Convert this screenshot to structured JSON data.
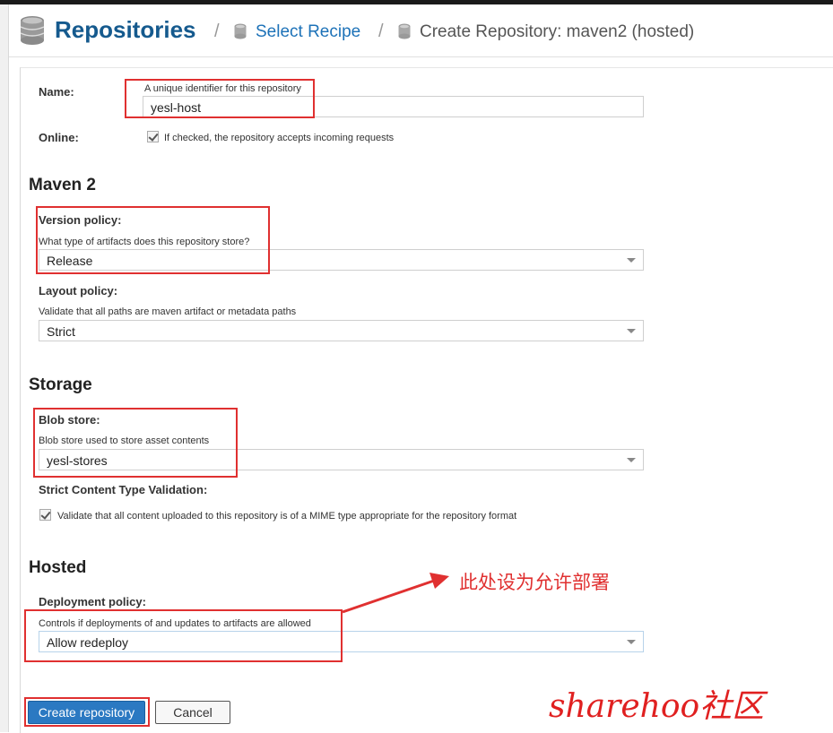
{
  "breadcrumb": {
    "title": "Repositories",
    "separator": "/",
    "link": "Select Recipe",
    "current": "Create Repository: maven2 (hosted)"
  },
  "form": {
    "name": {
      "label": "Name:",
      "help": "A unique identifier for this repository",
      "value": "yesl-host"
    },
    "online": {
      "label": "Online:",
      "checked": true,
      "help": "If checked, the repository accepts incoming requests"
    },
    "maven": {
      "section_title": "Maven 2",
      "version_policy": {
        "label": "Version policy:",
        "help": "What type of artifacts does this repository store?",
        "value": "Release"
      },
      "layout_policy": {
        "label": "Layout policy:",
        "help": "Validate that all paths are maven artifact or metadata paths",
        "value": "Strict"
      }
    },
    "storage": {
      "section_title": "Storage",
      "blob_store": {
        "label": "Blob store:",
        "help": "Blob store used to store asset contents",
        "value": "yesl-stores"
      },
      "strict_content": {
        "label": "Strict Content Type Validation:",
        "checked": true,
        "help": "Validate that all content uploaded to this repository is of a MIME type appropriate for the repository format"
      }
    },
    "hosted": {
      "section_title": "Hosted",
      "deployment_policy": {
        "label": "Deployment policy:",
        "help": "Controls if deployments of and updates to artifacts are allowed",
        "value": "Allow redeploy"
      }
    },
    "buttons": {
      "create": "Create repository",
      "cancel": "Cancel"
    }
  },
  "annotations": {
    "arrow_note": "此处设为允许部署",
    "watermark": "sharehoo社区",
    "color": "#e03030"
  },
  "colors": {
    "title": "#155a8e",
    "link": "#1d72b8",
    "primary_button": "#2b79c2"
  }
}
